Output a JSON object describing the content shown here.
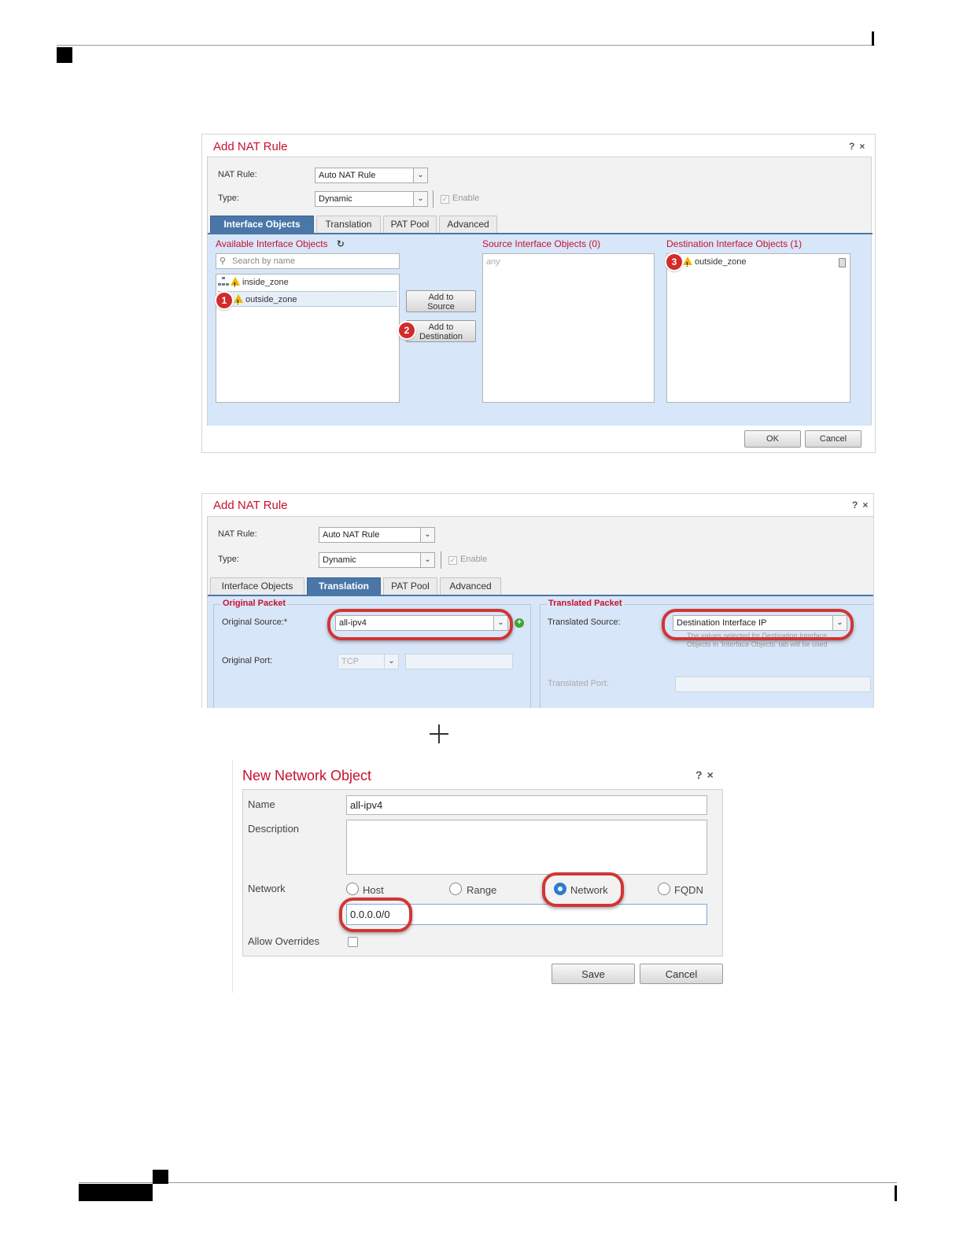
{
  "dialog1": {
    "title": "Add NAT Rule",
    "help": "?",
    "close": "×",
    "nat_rule_label": "NAT Rule:",
    "nat_rule_value": "Auto NAT Rule",
    "type_label": "Type:",
    "type_value": "Dynamic",
    "enable_label": "Enable",
    "tabs": [
      "Interface Objects",
      "Translation",
      "PAT Pool",
      "Advanced"
    ],
    "active_tab": "Interface Objects",
    "available_header": "Available Interface Objects",
    "search_placeholder": "Search by name",
    "available_items": [
      "inside_zone",
      "outside_zone"
    ],
    "add_source_btn": [
      "Add to",
      "Source"
    ],
    "add_dest_btn": [
      "Add to",
      "Destination"
    ],
    "source_header": "Source Interface Objects (0)",
    "source_placeholder": "any",
    "dest_header": "Destination Interface Objects (1)",
    "dest_items": [
      "outside_zone"
    ],
    "ok": "OK",
    "cancel": "Cancel",
    "steps": [
      "1",
      "2",
      "3"
    ]
  },
  "dialog2": {
    "title": "Add NAT Rule",
    "help": "?",
    "close": "×",
    "nat_rule_label": "NAT Rule:",
    "nat_rule_value": "Auto NAT Rule",
    "type_label": "Type:",
    "type_value": "Dynamic",
    "enable_label": "Enable",
    "tabs": [
      "Interface Objects",
      "Translation",
      "PAT Pool",
      "Advanced"
    ],
    "active_tab": "Translation",
    "original_packet_legend": "Original Packet",
    "original_source_label": "Original Source:*",
    "original_source_value": "all-ipv4",
    "original_port_label": "Original Port:",
    "original_port_protocol": "TCP",
    "translated_packet_legend": "Translated Packet",
    "translated_source_label": "Translated Source:",
    "translated_source_value": "Destination Interface IP",
    "translated_note_1": "The values selected for Destination Interface",
    "translated_note_2": "Objects in 'Interface Objects' tab will be used",
    "translated_port_label": "Translated Port:"
  },
  "connector": "+",
  "dialog3": {
    "title": "New Network Object",
    "help": "?",
    "close": "×",
    "name_label": "Name",
    "name_value": "all-ipv4",
    "description_label": "Description",
    "description_value": "",
    "network_label": "Network",
    "network_types": [
      "Host",
      "Range",
      "Network",
      "FQDN"
    ],
    "network_selected": "Network",
    "network_value": "0.0.0.0/0",
    "allow_overrides_label": "Allow Overrides",
    "save": "Save",
    "cancel": "Cancel"
  },
  "colors": {
    "title_red": "#c8102e",
    "tab_active": "#4a77a8",
    "panel_blue": "#d7e6f8",
    "callout_red": "#d23535"
  }
}
